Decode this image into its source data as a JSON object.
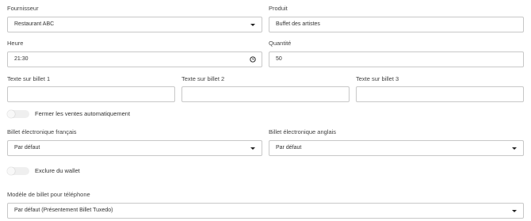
{
  "fournisseur": {
    "label": "Fournisseur",
    "value": "Restaurant ABC"
  },
  "produit": {
    "label": "Produit",
    "value": "Buffet des artistes"
  },
  "heure": {
    "label": "Heure",
    "value": "21:30"
  },
  "quantite": {
    "label": "Quantité",
    "value": "50"
  },
  "billet_texts": [
    {
      "label": "Texte sur billet 1",
      "value": ""
    },
    {
      "label": "Texte sur billet 2",
      "value": ""
    },
    {
      "label": "Texte sur billet 3",
      "value": ""
    }
  ],
  "toggle_fermer": {
    "label": "Fermer les ventes automatiquement",
    "on": false
  },
  "billet_fr": {
    "label": "Billet électronique français",
    "value": "Par défaut"
  },
  "billet_en": {
    "label": "Billet électronique anglais",
    "value": "Par défaut"
  },
  "toggle_wallet": {
    "label": "Exclure du wallet",
    "on": false
  },
  "modele": {
    "label": "Modèle de billet pour téléphone",
    "value": "Par défaut (Présentement Billet Tuxedo)"
  }
}
